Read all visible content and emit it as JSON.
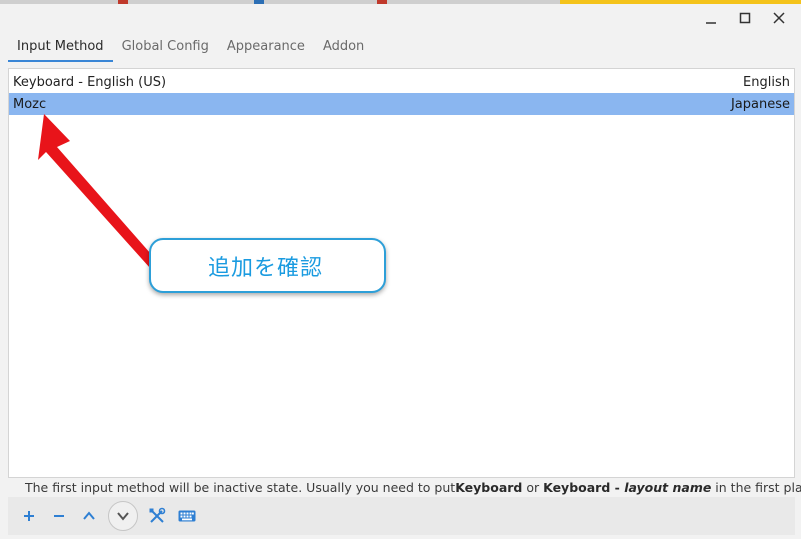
{
  "window": {
    "minimize_icon": "minimize-icon",
    "maximize_icon": "maximize-icon",
    "close_icon": "close-icon"
  },
  "tabs": [
    {
      "label": "Input Method",
      "active": true
    },
    {
      "label": "Global Config",
      "active": false
    },
    {
      "label": "Appearance",
      "active": false
    },
    {
      "label": "Addon",
      "active": false
    }
  ],
  "input_methods": [
    {
      "name": "Keyboard - English (US)",
      "language": "English",
      "selected": false
    },
    {
      "name": "Mozc",
      "language": "Japanese",
      "selected": true
    }
  ],
  "annotation": {
    "callout_text": "追加を確認"
  },
  "info": {
    "part1": "The first input method will be inactive state. Usually you need to put ",
    "bold1": "Keyboard",
    "part2": " or ",
    "bold2": "Keyboard - ",
    "italic": "layout name",
    "part3": " in the first place."
  },
  "toolbar": {
    "add_icon": "plus-icon",
    "remove_icon": "minus-icon",
    "up_icon": "chevron-up-icon",
    "down_icon": "chevron-down-icon",
    "configure_icon": "tools-icon",
    "keyboard_icon": "keyboard-icon"
  },
  "colors": {
    "accent": "#2e7fd3",
    "selection": "#8ab6f0",
    "callout_border": "#2d9fd8",
    "callout_text": "#1a9be0",
    "arrow": "#e8141a"
  }
}
